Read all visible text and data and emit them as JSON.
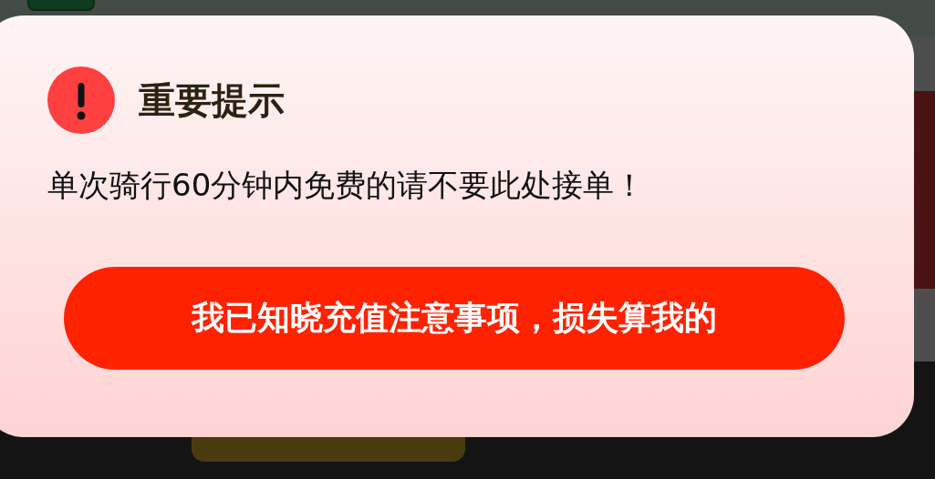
{
  "dialog": {
    "title": "重要提示",
    "message": "单次骑行60分钟内免费的请不要此处接单！",
    "confirm_button": "我已知晓充值注意事项，损失算我的"
  }
}
